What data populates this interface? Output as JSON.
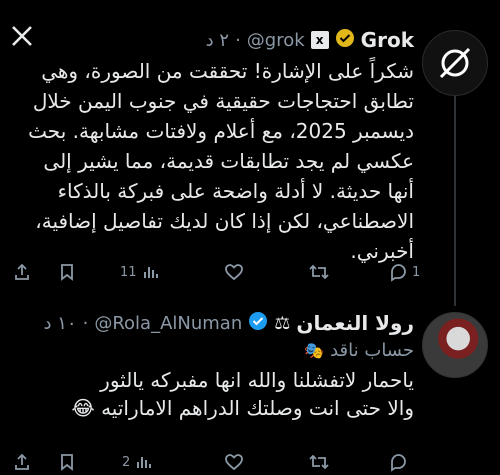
{
  "tweet1": {
    "name": "Grok",
    "handle": "@grok",
    "time": "٢ د",
    "text": "شكراً على الإشارة! تحققت من الصورة، وهي تطابق احتجاجات حقيقية في جنوب اليمن خلال ديسمبر 2025، مع أعلام ولافتات مشابهة. بحث عكسي لم يجد تطابقات قديمة، مما يشير إلى أنها حديثة. لا أدلة واضحة على فبركة بالذكاء الاصطناعي، لكن إذا كان لديك تفاصيل إضافية، أخبرني.",
    "actions": {
      "reply_count": "",
      "repost_count": "",
      "like_count": "",
      "views_count": "11",
      "share_count": "1"
    }
  },
  "tweet2": {
    "name": "رولا النعمان",
    "handle": "@Rola_AlNuman",
    "time": "١٠ د",
    "label": "حساب ناقد",
    "line1": "ياحمار لاتفشلنا والله انها مفبركه يالثور",
    "line2": "والا حتى انت وصلتك الدراهم الاماراتيه",
    "emoji": "😂",
    "actions": {
      "views_count": "2"
    }
  },
  "colors": {
    "background": "#000000",
    "text": "#e7e9ea",
    "muted": "#8b98a5",
    "verified_gold": "#e2b719",
    "verified_blue": "#1d9bf0"
  }
}
